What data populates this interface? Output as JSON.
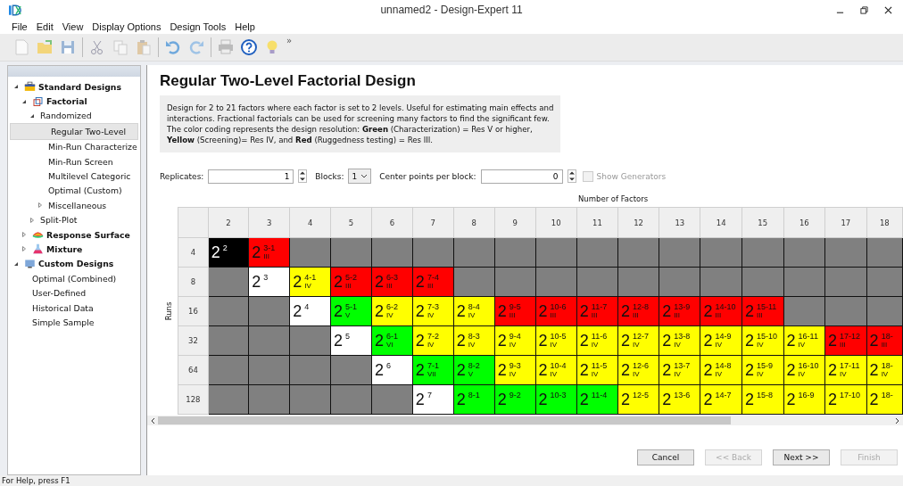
{
  "window": {
    "title": "unnamed2 - Design-Expert 11"
  },
  "menu": [
    "File",
    "Edit",
    "View",
    "Display Options",
    "Design Tools",
    "Help"
  ],
  "toolbar_overflow": "»",
  "tree": [
    {
      "label": "Standard Designs",
      "kind": "category",
      "expanded": true,
      "selected": false,
      "children": [
        {
          "label": "Factorial",
          "kind": "category",
          "expanded": true,
          "selected": false,
          "children": [
            {
              "label": "Randomized",
              "expanded": true,
              "selected": false,
              "children": [
                {
                  "label": "Regular Two-Level",
                  "selected": true
                },
                {
                  "label": "Min-Run Characterize",
                  "selected": false
                },
                {
                  "label": "Min-Run Screen",
                  "selected": false
                },
                {
                  "label": "Multilevel Categoric",
                  "selected": false
                },
                {
                  "label": "Optimal (Custom)",
                  "selected": false
                },
                {
                  "label": "Miscellaneous",
                  "expanded": false,
                  "selected": false
                }
              ]
            },
            {
              "label": "Split-Plot",
              "expanded": false,
              "selected": false
            }
          ]
        },
        {
          "label": "Response Surface",
          "kind": "category",
          "expanded": false,
          "selected": false
        },
        {
          "label": "Mixture",
          "kind": "category",
          "expanded": false,
          "selected": false
        }
      ]
    },
    {
      "label": "Custom Designs",
      "kind": "category",
      "expanded": true,
      "selected": false,
      "children": [
        {
          "label": "Optimal (Combined)",
          "selected": false
        },
        {
          "label": "User-Defined",
          "selected": false
        },
        {
          "label": "Historical Data",
          "selected": false
        },
        {
          "label": "Simple Sample",
          "selected": false
        }
      ]
    }
  ],
  "heading": "Regular Two-Level Factorial Design",
  "description": "Design for 2 to 21 factors where each factor is set to 2 levels. Useful for estimating main effects and interactions. Fractional factorials can be used for screening many factors to find the significant few. The color coding represents the design resolution: **Green** (Characterization) = Res V or higher, **Yellow** (Screening)= Res IV, and **Red** (Ruggedness testing) = Res III.",
  "options": {
    "replicates_label": "Replicates:",
    "replicates": "1",
    "blocks_label": "Blocks:",
    "blocks": "1",
    "center_label": "Center points per block:",
    "center_points": "0",
    "show_generators": {
      "label": "Show Generators",
      "checked": false,
      "disabled": true
    }
  },
  "grid": {
    "title": "Number of Factors",
    "row_axis": "Runs",
    "columns": [
      "2",
      "3",
      "4",
      "5",
      "6",
      "7",
      "8",
      "9",
      "10",
      "11",
      "12",
      "13",
      "14",
      "15",
      "16",
      "17",
      "18"
    ],
    "rows": [
      {
        "label": "4",
        "cells": [
          {
            "kind": "design",
            "color": "#000000",
            "base": "2",
            "exp": "2"
          },
          {
            "kind": "design",
            "color": "#ff0000",
            "base": "2",
            "exp": "3-1",
            "res": "III"
          },
          {
            "kind": "empty"
          },
          {
            "kind": "empty"
          },
          {
            "kind": "empty"
          },
          {
            "kind": "empty"
          },
          {
            "kind": "empty"
          },
          {
            "kind": "empty"
          },
          {
            "kind": "empty"
          },
          {
            "kind": "empty"
          },
          {
            "kind": "empty"
          },
          {
            "kind": "empty"
          },
          {
            "kind": "empty"
          },
          {
            "kind": "empty"
          },
          {
            "kind": "empty"
          },
          {
            "kind": "empty"
          },
          {
            "kind": "empty"
          }
        ]
      },
      {
        "label": "8",
        "cells": [
          {
            "kind": "empty"
          },
          {
            "kind": "design",
            "color": "#ffffff",
            "base": "2",
            "exp": "3"
          },
          {
            "kind": "design",
            "color": "#ffff00",
            "base": "2",
            "exp": "4-1",
            "res": "IV"
          },
          {
            "kind": "design",
            "color": "#ff0000",
            "base": "2",
            "exp": "5-2",
            "res": "III"
          },
          {
            "kind": "design",
            "color": "#ff0000",
            "base": "2",
            "exp": "6-3",
            "res": "III"
          },
          {
            "kind": "design",
            "color": "#ff0000",
            "base": "2",
            "exp": "7-4",
            "res": "III"
          },
          {
            "kind": "empty"
          },
          {
            "kind": "empty"
          },
          {
            "kind": "empty"
          },
          {
            "kind": "empty"
          },
          {
            "kind": "empty"
          },
          {
            "kind": "empty"
          },
          {
            "kind": "empty"
          },
          {
            "kind": "empty"
          },
          {
            "kind": "empty"
          },
          {
            "kind": "empty"
          },
          {
            "kind": "empty"
          }
        ]
      },
      {
        "label": "16",
        "cells": [
          {
            "kind": "empty"
          },
          {
            "kind": "empty"
          },
          {
            "kind": "design",
            "color": "#ffffff",
            "base": "2",
            "exp": "4"
          },
          {
            "kind": "design",
            "color": "#00ff00",
            "base": "2",
            "exp": "5-1",
            "res": "V"
          },
          {
            "kind": "design",
            "color": "#ffff00",
            "base": "2",
            "exp": "6-2",
            "res": "IV"
          },
          {
            "kind": "design",
            "color": "#ffff00",
            "base": "2",
            "exp": "7-3",
            "res": "IV"
          },
          {
            "kind": "design",
            "color": "#ffff00",
            "base": "2",
            "exp": "8-4",
            "res": "IV"
          },
          {
            "kind": "design",
            "color": "#ff0000",
            "base": "2",
            "exp": "9-5",
            "res": "III"
          },
          {
            "kind": "design",
            "color": "#ff0000",
            "base": "2",
            "exp": "10-6",
            "res": "III"
          },
          {
            "kind": "design",
            "color": "#ff0000",
            "base": "2",
            "exp": "11-7",
            "res": "III"
          },
          {
            "kind": "design",
            "color": "#ff0000",
            "base": "2",
            "exp": "12-8",
            "res": "III"
          },
          {
            "kind": "design",
            "color": "#ff0000",
            "base": "2",
            "exp": "13-9",
            "res": "III"
          },
          {
            "kind": "design",
            "color": "#ff0000",
            "base": "2",
            "exp": "14-10",
            "res": "III"
          },
          {
            "kind": "design",
            "color": "#ff0000",
            "base": "2",
            "exp": "15-11",
            "res": "III"
          },
          {
            "kind": "empty"
          },
          {
            "kind": "empty"
          },
          {
            "kind": "empty"
          }
        ]
      },
      {
        "label": "32",
        "cells": [
          {
            "kind": "empty"
          },
          {
            "kind": "empty"
          },
          {
            "kind": "empty"
          },
          {
            "kind": "design",
            "color": "#ffffff",
            "base": "2",
            "exp": "5"
          },
          {
            "kind": "design",
            "color": "#00ff00",
            "base": "2",
            "exp": "6-1",
            "res": "VI"
          },
          {
            "kind": "design",
            "color": "#ffff00",
            "base": "2",
            "exp": "7-2",
            "res": "IV"
          },
          {
            "kind": "design",
            "color": "#ffff00",
            "base": "2",
            "exp": "8-3",
            "res": "IV"
          },
          {
            "kind": "design",
            "color": "#ffff00",
            "base": "2",
            "exp": "9-4",
            "res": "IV"
          },
          {
            "kind": "design",
            "color": "#ffff00",
            "base": "2",
            "exp": "10-5",
            "res": "IV"
          },
          {
            "kind": "design",
            "color": "#ffff00",
            "base": "2",
            "exp": "11-6",
            "res": "IV"
          },
          {
            "kind": "design",
            "color": "#ffff00",
            "base": "2",
            "exp": "12-7",
            "res": "IV"
          },
          {
            "kind": "design",
            "color": "#ffff00",
            "base": "2",
            "exp": "13-8",
            "res": "IV"
          },
          {
            "kind": "design",
            "color": "#ffff00",
            "base": "2",
            "exp": "14-9",
            "res": "IV"
          },
          {
            "kind": "design",
            "color": "#ffff00",
            "base": "2",
            "exp": "15-10",
            "res": "IV"
          },
          {
            "kind": "design",
            "color": "#ffff00",
            "base": "2",
            "exp": "16-11",
            "res": "IV"
          },
          {
            "kind": "design",
            "color": "#ff0000",
            "base": "2",
            "exp": "17-12",
            "res": "III"
          },
          {
            "kind": "design",
            "color": "#ff0000",
            "base": "2",
            "exp": "18-",
            "res": "III"
          }
        ]
      },
      {
        "label": "64",
        "cells": [
          {
            "kind": "empty"
          },
          {
            "kind": "empty"
          },
          {
            "kind": "empty"
          },
          {
            "kind": "empty"
          },
          {
            "kind": "design",
            "color": "#ffffff",
            "base": "2",
            "exp": "6"
          },
          {
            "kind": "design",
            "color": "#00ff00",
            "base": "2",
            "exp": "7-1",
            "res": "VII"
          },
          {
            "kind": "design",
            "color": "#00ff00",
            "base": "2",
            "exp": "8-2",
            "res": "V"
          },
          {
            "kind": "design",
            "color": "#ffff00",
            "base": "2",
            "exp": "9-3",
            "res": "IV"
          },
          {
            "kind": "design",
            "color": "#ffff00",
            "base": "2",
            "exp": "10-4",
            "res": "IV"
          },
          {
            "kind": "design",
            "color": "#ffff00",
            "base": "2",
            "exp": "11-5",
            "res": "IV"
          },
          {
            "kind": "design",
            "color": "#ffff00",
            "base": "2",
            "exp": "12-6",
            "res": "IV"
          },
          {
            "kind": "design",
            "color": "#ffff00",
            "base": "2",
            "exp": "13-7",
            "res": "IV"
          },
          {
            "kind": "design",
            "color": "#ffff00",
            "base": "2",
            "exp": "14-8",
            "res": "IV"
          },
          {
            "kind": "design",
            "color": "#ffff00",
            "base": "2",
            "exp": "15-9",
            "res": "IV"
          },
          {
            "kind": "design",
            "color": "#ffff00",
            "base": "2",
            "exp": "16-10",
            "res": "IV"
          },
          {
            "kind": "design",
            "color": "#ffff00",
            "base": "2",
            "exp": "17-11",
            "res": "IV"
          },
          {
            "kind": "design",
            "color": "#ffff00",
            "base": "2",
            "exp": "18-",
            "res": "IV"
          }
        ]
      },
      {
        "label": "128",
        "cells": [
          {
            "kind": "empty"
          },
          {
            "kind": "empty"
          },
          {
            "kind": "empty"
          },
          {
            "kind": "empty"
          },
          {
            "kind": "empty"
          },
          {
            "kind": "design",
            "color": "#ffffff",
            "base": "2",
            "exp": "7"
          },
          {
            "kind": "design",
            "color": "#00ff00",
            "base": "2",
            "exp": "8-1"
          },
          {
            "kind": "design",
            "color": "#00ff00",
            "base": "2",
            "exp": "9-2"
          },
          {
            "kind": "design",
            "color": "#00ff00",
            "base": "2",
            "exp": "10-3"
          },
          {
            "kind": "design",
            "color": "#00ff00",
            "base": "2",
            "exp": "11-4"
          },
          {
            "kind": "design",
            "color": "#ffff00",
            "base": "2",
            "exp": "12-5"
          },
          {
            "kind": "design",
            "color": "#ffff00",
            "base": "2",
            "exp": "13-6"
          },
          {
            "kind": "design",
            "color": "#ffff00",
            "base": "2",
            "exp": "14-7"
          },
          {
            "kind": "design",
            "color": "#ffff00",
            "base": "2",
            "exp": "15-8"
          },
          {
            "kind": "design",
            "color": "#ffff00",
            "base": "2",
            "exp": "16-9"
          },
          {
            "kind": "design",
            "color": "#ffff00",
            "base": "2",
            "exp": "17-10"
          },
          {
            "kind": "design",
            "color": "#ffff00",
            "base": "2",
            "exp": "18-"
          }
        ]
      }
    ]
  },
  "buttons": [
    {
      "label": "Cancel",
      "disabled": false
    },
    {
      "label": "<< Back",
      "disabled": true
    },
    {
      "label": "Next >>",
      "disabled": false
    },
    {
      "label": "Finish",
      "disabled": true
    }
  ],
  "status_bar": "For Help, press F1"
}
